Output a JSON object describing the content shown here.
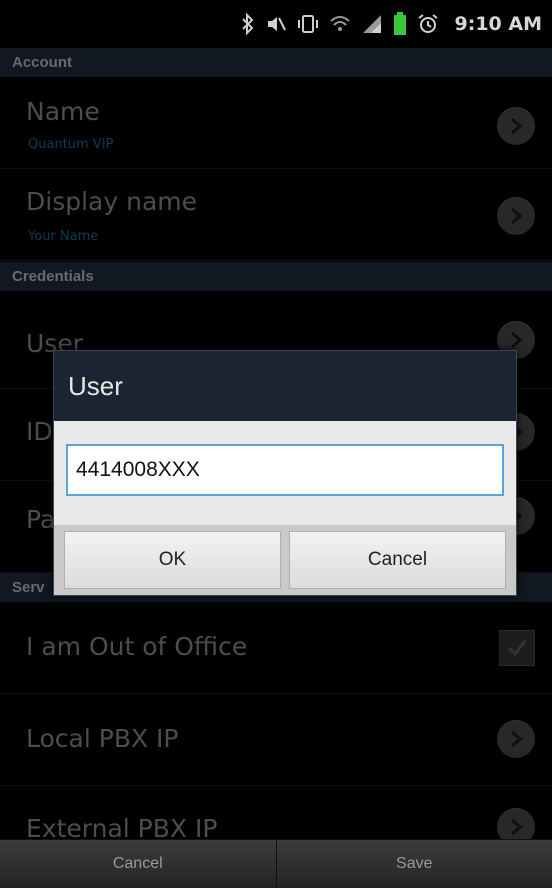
{
  "status_bar": {
    "time": "9:10 AM",
    "icons": [
      "bluetooth-icon",
      "mute-icon",
      "vibrate-icon",
      "wifi-icon",
      "signal-icon",
      "battery-icon",
      "alarm-icon"
    ]
  },
  "sections": {
    "account": "Account",
    "credentials": "Credentials",
    "services": "Serv"
  },
  "rows": {
    "name": {
      "title": "Name",
      "subtitle": "Quantum VIP"
    },
    "display_name": {
      "title": "Display name",
      "subtitle": "Your Name"
    },
    "user": {
      "title": "User"
    },
    "id": {
      "title": "ID"
    },
    "password": {
      "title": "Pa"
    },
    "out_of_office": {
      "title": "I am Out of Office",
      "checked": true
    },
    "local_pbx": {
      "title": "Local PBX IP"
    },
    "external_pbx": {
      "title": "External PBX IP"
    }
  },
  "dialog": {
    "title": "User",
    "input_value": "4414008XXX",
    "ok_label": "OK",
    "cancel_label": "Cancel"
  },
  "bottom_bar": {
    "cancel_label": "Cancel",
    "save_label": "Save"
  },
  "colors": {
    "section_header_bg": "#1f2d3d",
    "subtitle": "#1b6a8c",
    "dialog_bg": "#1a2433",
    "input_focus_border": "#5aa3d8"
  }
}
